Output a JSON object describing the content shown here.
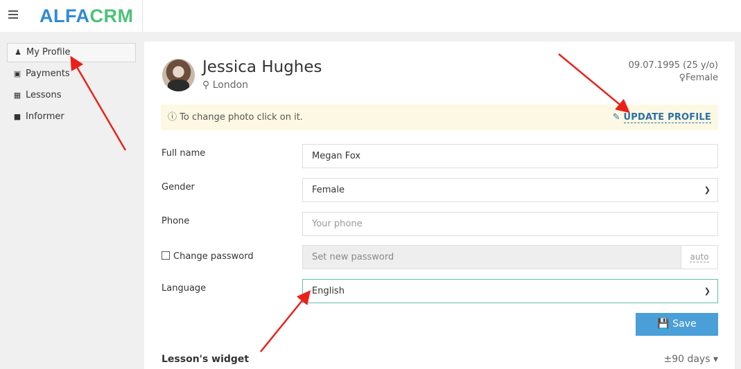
{
  "app": {
    "logo_part1": "ALFA",
    "logo_part2": "CRM"
  },
  "sidebar": {
    "items": [
      {
        "label": "My Profile",
        "icon": "user-icon",
        "active": true
      },
      {
        "label": "Payments",
        "icon": "money-icon"
      },
      {
        "label": "Lessons",
        "icon": "calendar-icon"
      },
      {
        "label": "Informer",
        "icon": "book-icon"
      }
    ]
  },
  "profile": {
    "name": "Jessica Hughes",
    "city": "London",
    "dob": "09.07.1995 (25 y/o)",
    "gender": "Female"
  },
  "alert": {
    "text": "To change photo click on it.",
    "action": "UPDATE PROFILE"
  },
  "form": {
    "full_name_label": "Full name",
    "full_name_value": "Megan Fox",
    "gender_label": "Gender",
    "gender_value": "Female",
    "phone_label": "Phone",
    "phone_placeholder": "Your phone",
    "password_label": "Change password",
    "password_placeholder": "Set new password",
    "password_auto": "auto",
    "language_label": "Language",
    "language_value": "English",
    "save_label": "Save"
  },
  "widget": {
    "title": "Lesson's widget",
    "range": "±90 days"
  },
  "colors": {
    "accent": "#4a9fd8",
    "annotation_arrow": "#e8221b",
    "alert_bg": "#fcf8e3"
  }
}
